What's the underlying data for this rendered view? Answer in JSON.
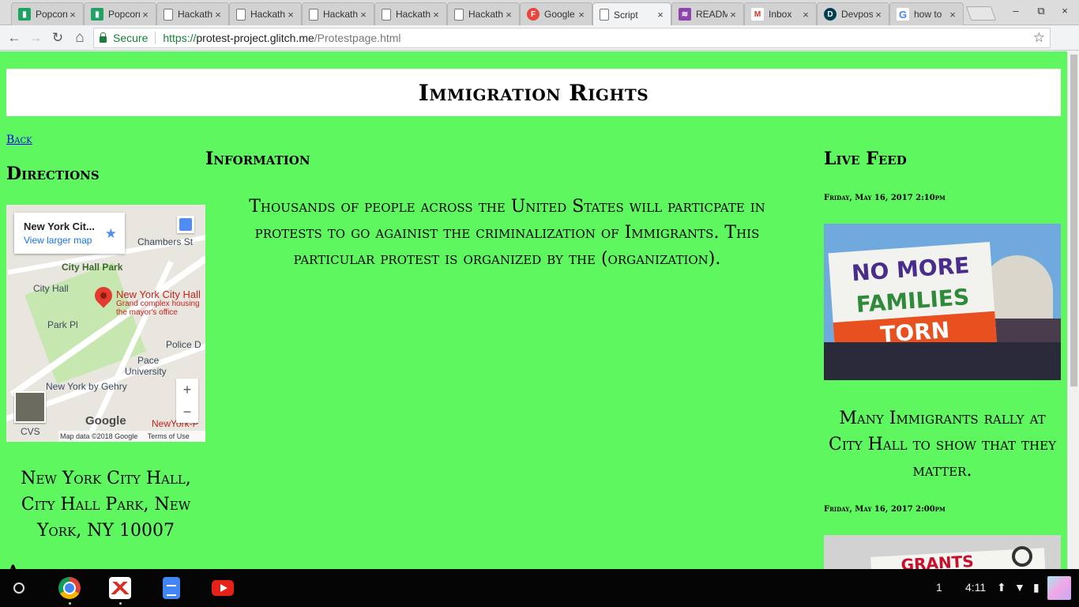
{
  "browser": {
    "tabs": [
      {
        "title": "Popcorn",
        "icon": "popcorn-icon",
        "color": "#1ea362"
      },
      {
        "title": "Popcorn",
        "icon": "popcorn-icon",
        "color": "#1ea362"
      },
      {
        "title": "Hackathon",
        "icon": "page-icon"
      },
      {
        "title": "Hackathon",
        "icon": "page-icon"
      },
      {
        "title": "Hackathon",
        "icon": "page-icon"
      },
      {
        "title": "Hackathon",
        "icon": "page-icon"
      },
      {
        "title": "Hackathon",
        "icon": "page-icon"
      },
      {
        "title": "Google",
        "icon": "google-forms-icon",
        "color": "#e8453c",
        "glyph": "F"
      },
      {
        "title": "Script",
        "icon": "page-icon",
        "active": true
      },
      {
        "title": "README",
        "icon": "readme-icon",
        "color": "#8e44ad"
      },
      {
        "title": "Inbox",
        "icon": "gmail-icon",
        "color": "#d93025",
        "glyph": "M"
      },
      {
        "title": "Devpost",
        "icon": "devpost-icon",
        "color": "#003e54",
        "glyph": "D"
      },
      {
        "title": "how to",
        "icon": "google-icon",
        "color": "#4285f4",
        "glyph": "G"
      }
    ],
    "close_glyph": "×",
    "window": {
      "minimize": "–",
      "restore": "⧉",
      "close": "×"
    },
    "nav": {
      "back": "←",
      "forward": "→",
      "reload": "↻",
      "home": "⌂"
    },
    "security_label": "Secure",
    "url": {
      "scheme": "https://",
      "host": "protest-project.glitch.me",
      "path": "/Protestpage.html"
    },
    "bookmark_star": "☆",
    "menu": "⋮"
  },
  "page": {
    "background_color": "#5ff75f",
    "header_title": "Immigration Rights",
    "back_link": "Back",
    "directions_title": "Directions",
    "information_title": "Information",
    "information_text": "Thousands of people across the United States will particpate in protests to go againist the criminalization of Immigrants. This particular protest is organized by the (organization).",
    "live_feed_title": "Live Feed",
    "map": {
      "place_name": "New York Cit...",
      "view_larger": "View larger map",
      "labels": {
        "chambers": "Chambers St",
        "city_hall_park": "City Hall Park",
        "city_hall_station": "City Hall",
        "park_pl": "Park Pl",
        "police": "Police D",
        "pace_1": "Pace",
        "pace_2": "University",
        "gehry": "New York by Gehry",
        "cvs": "CVS",
        "nyp": "NewYork-P"
      },
      "pin_label": "New York City Hall",
      "pin_sub_1": "Grand complex housing",
      "pin_sub_2": "the mayor's office",
      "zoom_in": "+",
      "zoom_out": "−",
      "logo": "Google",
      "map_data": "Map data ©2018 Google",
      "terms": "Terms of Use"
    },
    "address": "New York City Hall, City Hall Park, New York, NY 10007",
    "next_section_title": "Attendees",
    "feed": [
      {
        "date": "Friday, May 16, 2017 2:10pm",
        "sign_lines": [
          "NO MORE",
          "FAMILIES",
          "TORN APART"
        ],
        "caption": "Many Immigrants rally at City Hall to show that they matter."
      },
      {
        "date": "Friday, May 16, 2017 2:00pm",
        "sign_text": "GRANTS"
      }
    ]
  },
  "taskbar": {
    "apps": [
      "chrome-icon",
      "gmail-icon",
      "docs-icon",
      "youtube-icon"
    ],
    "notification_count": "1",
    "time": "4:11"
  }
}
